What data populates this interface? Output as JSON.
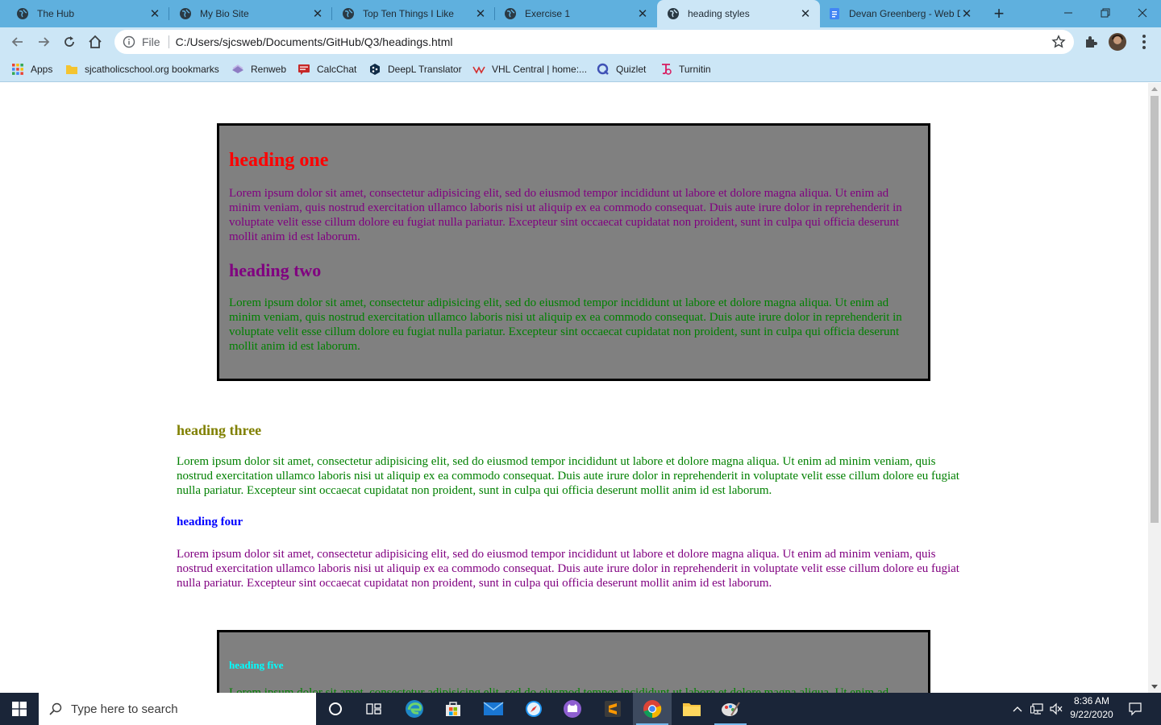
{
  "browser": {
    "tabs": [
      {
        "title": "The Hub",
        "icon": "globe-icon"
      },
      {
        "title": "My Bio Site",
        "icon": "globe-icon"
      },
      {
        "title": "Top Ten Things I Like",
        "icon": "globe-icon"
      },
      {
        "title": "Exercise 1",
        "icon": "globe-icon"
      },
      {
        "title": "heading styles",
        "icon": "globe-icon",
        "active": true
      },
      {
        "title": "Devan Greenberg - Web D",
        "icon": "docs-icon"
      }
    ],
    "address": {
      "scheme_label": "File",
      "url": "C:/Users/sjcsweb/Documents/GitHub/Q3/headings.html"
    },
    "bookmarks": [
      {
        "label": "Apps",
        "icon": "apps-grid-icon"
      },
      {
        "label": "sjcatholicschool.org bookmarks",
        "icon": "folder-icon"
      },
      {
        "label": "Renweb",
        "icon": "renweb-icon"
      },
      {
        "label": "CalcChat",
        "icon": "calcchat-icon"
      },
      {
        "label": "DeepL Translator",
        "icon": "deepl-icon"
      },
      {
        "label": "VHL Central | home:...",
        "icon": "vhl-icon"
      },
      {
        "label": "Quizlet",
        "icon": "quizlet-icon"
      },
      {
        "label": "Turnitin",
        "icon": "turnitin-icon"
      }
    ]
  },
  "page": {
    "box1": {
      "heading_one": "heading one",
      "para_one": "Lorem ipsum dolor sit amet, consectetur adipisicing elit, sed do eiusmod tempor incididunt ut labore et dolore magna aliqua. Ut enim ad minim veniam, quis nostrud exercitation ullamco laboris nisi ut aliquip ex ea commodo consequat. Duis aute irure dolor in reprehenderit in voluptate velit esse cillum dolore eu fugiat nulla pariatur. Excepteur sint occaecat cupidatat non proident, sunt in culpa qui officia deserunt mollit anim id est laborum.",
      "heading_two": "heading two",
      "para_two": "Lorem ipsum dolor sit amet, consectetur adipisicing elit, sed do eiusmod tempor incididunt ut labore et dolore magna aliqua. Ut enim ad minim veniam, quis nostrud exercitation ullamco laboris nisi ut aliquip ex ea commodo consequat. Duis aute irure dolor in reprehenderit in voluptate velit esse cillum dolore eu fugiat nulla pariatur. Excepteur sint occaecat cupidatat non proident, sunt in culpa qui officia deserunt mollit anim id est laborum."
    },
    "plain": {
      "heading_three": "heading three",
      "para_three": "Lorem ipsum dolor sit amet, consectetur adipisicing elit, sed do eiusmod tempor incididunt ut labore et dolore magna aliqua. Ut enim ad minim veniam, quis nostrud exercitation ullamco laboris nisi ut aliquip ex ea commodo consequat. Duis aute irure dolor in reprehenderit in voluptate velit esse cillum dolore eu fugiat nulla pariatur. Excepteur sint occaecat cupidatat non proident, sunt in culpa qui officia deserunt mollit anim id est laborum.",
      "heading_four": "heading four",
      "para_four": "Lorem ipsum dolor sit amet, consectetur adipisicing elit, sed do eiusmod tempor incididunt ut labore et dolore magna aliqua. Ut enim ad minim veniam, quis nostrud exercitation ullamco laboris nisi ut aliquip ex ea commodo consequat. Duis aute irure dolor in reprehenderit in voluptate velit esse cillum dolore eu fugiat nulla pariatur. Excepteur sint occaecat cupidatat non proident, sunt in culpa qui officia deserunt mollit anim id est laborum."
    },
    "box2": {
      "heading_five": "heading five",
      "para_five": "Lorem ipsum dolor sit amet, consectetur adipisicing elit, sed do eiusmod tempor incididunt ut labore et dolore magna aliqua. Ut enim ad minim veniam, quis nostrud exercitation ullamco laboris nisi ut aliquip ex ea commodo consequat."
    },
    "colors": {
      "box_background": "#808080",
      "heading_one": "#ff0000",
      "heading_two": "#800080",
      "heading_three": "#808000",
      "heading_four": "#0000ff",
      "heading_five": "#00ffff",
      "para_purple": "#800080",
      "para_green": "#008000"
    }
  },
  "taskbar": {
    "search_placeholder": "Type here to search",
    "apps": [
      "cortana-icon",
      "task-view-icon",
      "edge-icon",
      "store-icon",
      "mail-icon",
      "safari-icon",
      "github-desktop-icon",
      "sublime-text-icon",
      "chrome-icon",
      "file-explorer-icon",
      "paint-icon"
    ],
    "tray_icons": [
      "chevron-up-icon",
      "network-icon",
      "volume-muted-icon",
      "notification-icon"
    ],
    "clock_time": "8:36 AM",
    "clock_date": "9/22/2020"
  }
}
